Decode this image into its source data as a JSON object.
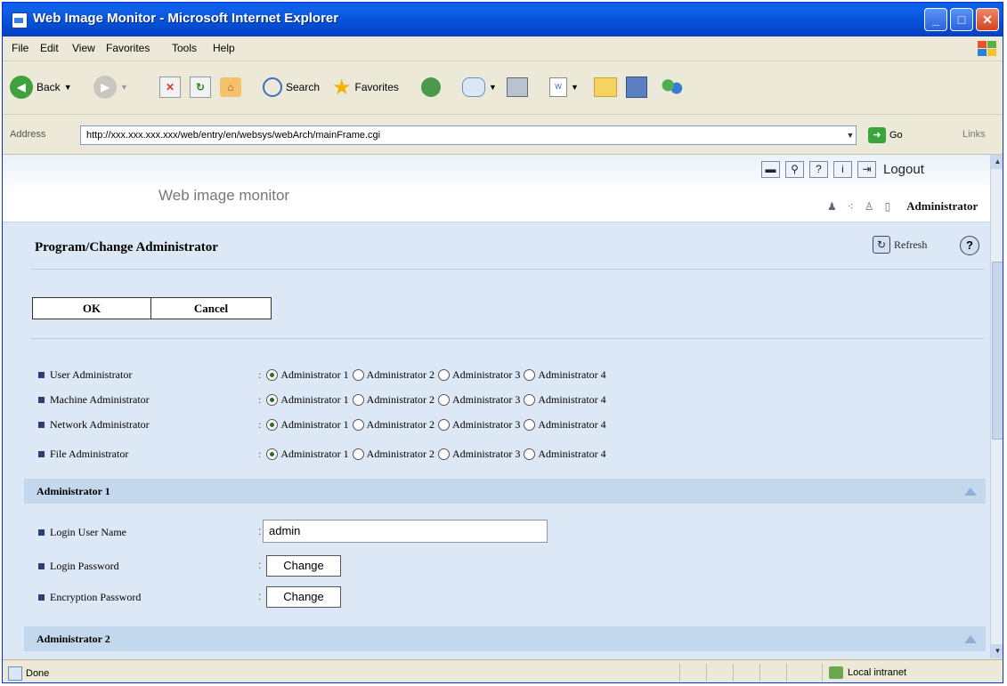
{
  "window": {
    "title": "Web Image Monitor - Microsoft Internet Explorer"
  },
  "menu": [
    "File",
    "Edit",
    "View",
    "Favorites",
    "Tools",
    "Help"
  ],
  "toolbar": {
    "back_label": "Back",
    "search_label": "Search",
    "favorites_label": "Favorites"
  },
  "address": {
    "label": "Address",
    "url": "http://xxx.xxx.xxx.xxx/web/entry/en/websys/webArch/mainFrame.cgi",
    "go_label": "Go",
    "links_label": "Links"
  },
  "header": {
    "brand": "Web image monitor",
    "logout_label": "Logout",
    "user_mode": "Administrator"
  },
  "page": {
    "title": "Program/Change Administrator",
    "refresh_label": "Refresh",
    "ok_label": "OK",
    "cancel_label": "Cancel"
  },
  "admin_roles": [
    {
      "label": "User Administrator",
      "selected": 0
    },
    {
      "label": "Machine Administrator",
      "selected": 0
    },
    {
      "label": "Network Administrator",
      "selected": 0
    },
    {
      "label": "File Administrator",
      "selected": 0
    }
  ],
  "admin_options": [
    "Administrator 1",
    "Administrator 2",
    "Administrator 3",
    "Administrator 4"
  ],
  "admin1": {
    "title": "Administrator 1",
    "login_user_label": "Login User Name",
    "login_user_value": "admin",
    "login_password_label": "Login Password",
    "encryption_password_label": "Encryption Password",
    "change_label": "Change"
  },
  "admin2": {
    "title": "Administrator 2"
  },
  "status": {
    "left": "Done",
    "zone": "Local intranet"
  }
}
